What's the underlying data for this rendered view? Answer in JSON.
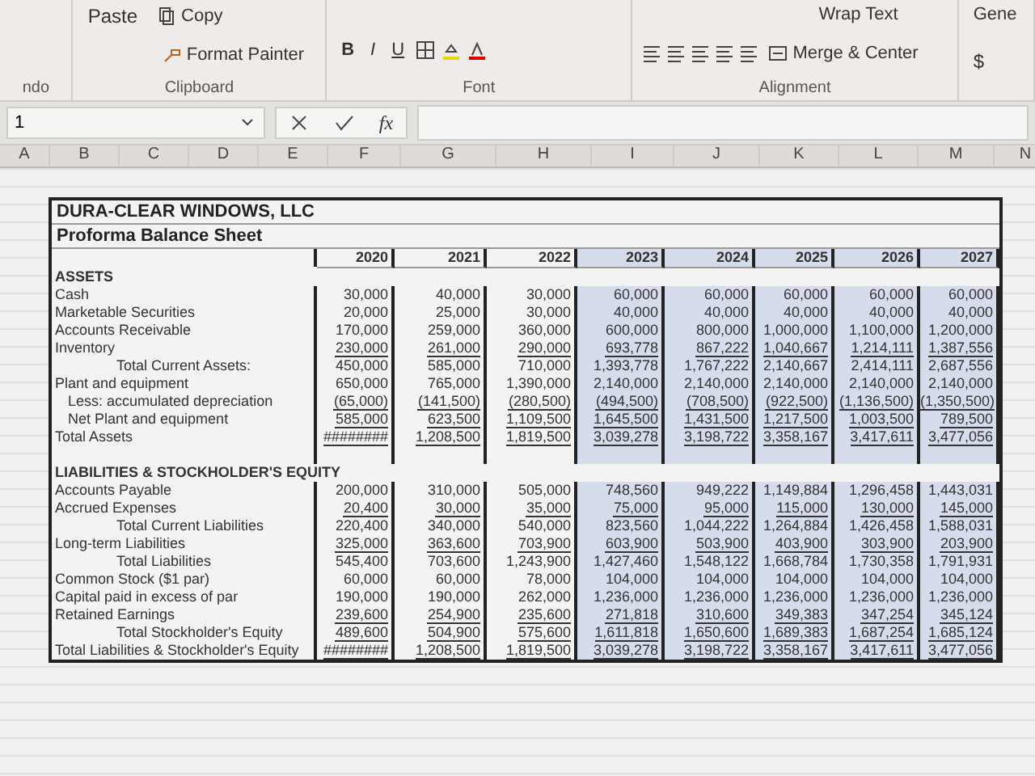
{
  "ribbon": {
    "undo_group": "ndo",
    "clipboard": {
      "paste": "Paste",
      "copy": "Copy",
      "format_painter": "Format Painter",
      "label": "Clipboard"
    },
    "font": {
      "bold": "B",
      "italic": "I",
      "underline": "U",
      "label": "Font"
    },
    "alignment": {
      "wrap_text": "Wrap Text",
      "merge": "Merge & Center",
      "label": "Alignment"
    },
    "number": {
      "format": "Gene",
      "currency": "$"
    }
  },
  "formula_bar": {
    "name_box": "1",
    "function_label": "fx"
  },
  "columns": [
    "A",
    "B",
    "C",
    "D",
    "E",
    "F",
    "G",
    "H",
    "I",
    "J",
    "K",
    "L",
    "M",
    "N"
  ],
  "sheet": {
    "title": "DURA-CLEAR WINDOWS, LLC",
    "subtitle": "Proforma Balance Sheet",
    "years": [
      {
        "label": "2020",
        "shaded": false
      },
      {
        "label": "2021",
        "shaded": false
      },
      {
        "label": "2022",
        "shaded": false
      },
      {
        "label": "2023",
        "shaded": true
      },
      {
        "label": "2024",
        "shaded": true
      },
      {
        "label": "2025",
        "shaded": true
      },
      {
        "label": "2026",
        "shaded": true
      },
      {
        "label": "2027",
        "shaded": true
      }
    ],
    "rows": [
      {
        "kind": "section",
        "label": "ASSETS",
        "values": []
      },
      {
        "kind": "item",
        "label": "Cash",
        "underlined": false,
        "values": [
          "30,000",
          "40,000",
          "30,000",
          "60,000",
          "60,000",
          "60,000",
          "60,000",
          "60,000"
        ]
      },
      {
        "kind": "item",
        "label": "Marketable Securities",
        "underlined": false,
        "values": [
          "20,000",
          "25,000",
          "30,000",
          "40,000",
          "40,000",
          "40,000",
          "40,000",
          "40,000"
        ]
      },
      {
        "kind": "item",
        "label": "Accounts Receivable",
        "underlined": false,
        "values": [
          "170,000",
          "259,000",
          "360,000",
          "600,000",
          "800,000",
          "1,000,000",
          "1,100,000",
          "1,200,000"
        ]
      },
      {
        "kind": "item",
        "label": "Inventory",
        "underlined": true,
        "values": [
          "230,000",
          "261,000",
          "290,000",
          "693,778",
          "867,222",
          "1,040,667",
          "1,214,111",
          "1,387,556"
        ]
      },
      {
        "kind": "total",
        "label": "Total Current Assets:",
        "underlined": false,
        "values": [
          "450,000",
          "585,000",
          "710,000",
          "1,393,778",
          "1,767,222",
          "2,140,667",
          "2,414,111",
          "2,687,556"
        ]
      },
      {
        "kind": "item",
        "label": "Plant and equipment",
        "underlined": false,
        "values": [
          "650,000",
          "765,000",
          "1,390,000",
          "2,140,000",
          "2,140,000",
          "2,140,000",
          "2,140,000",
          "2,140,000"
        ]
      },
      {
        "kind": "subitem",
        "label": "Less:  accumulated depreciation",
        "underlined": true,
        "values": [
          "(65,000)",
          "(141,500)",
          "(280,500)",
          "(494,500)",
          "(708,500)",
          "(922,500)",
          "(1,136,500)",
          "(1,350,500)"
        ]
      },
      {
        "kind": "subitem",
        "label": "Net Plant and equipment",
        "underlined": true,
        "values": [
          "585,000",
          "623,500",
          "1,109,500",
          "1,645,500",
          "1,431,500",
          "1,217,500",
          "1,003,500",
          "789,500"
        ]
      },
      {
        "kind": "item",
        "label": "Total Assets",
        "underlined": true,
        "values": [
          "########",
          "1,208,500",
          "1,819,500",
          "3,039,278",
          "3,198,722",
          "3,358,167",
          "3,417,611",
          "3,477,056"
        ]
      },
      {
        "kind": "blank",
        "values": []
      },
      {
        "kind": "section",
        "label": "LIABILITIES & STOCKHOLDER'S EQUITY",
        "values": []
      },
      {
        "kind": "item",
        "label": "Accounts Payable",
        "underlined": false,
        "values": [
          "200,000",
          "310,000",
          "505,000",
          "748,560",
          "949,222",
          "1,149,884",
          "1,296,458",
          "1,443,031"
        ]
      },
      {
        "kind": "item",
        "label": "Accrued Expenses",
        "underlined": true,
        "values": [
          "20,400",
          "30,000",
          "35,000",
          "75,000",
          "95,000",
          "115,000",
          "130,000",
          "145,000"
        ]
      },
      {
        "kind": "total",
        "label": "Total Current Liabilities",
        "underlined": false,
        "values": [
          "220,400",
          "340,000",
          "540,000",
          "823,560",
          "1,044,222",
          "1,264,884",
          "1,426,458",
          "1,588,031"
        ]
      },
      {
        "kind": "item",
        "label": "Long-term Liabilities",
        "underlined": true,
        "values": [
          "325,000",
          "363,600",
          "703,900",
          "603,900",
          "503,900",
          "403,900",
          "303,900",
          "203,900"
        ]
      },
      {
        "kind": "total",
        "label": "Total Liabilities",
        "underlined": false,
        "values": [
          "545,400",
          "703,600",
          "1,243,900",
          "1,427,460",
          "1,548,122",
          "1,668,784",
          "1,730,358",
          "1,791,931"
        ]
      },
      {
        "kind": "item",
        "label": "Common Stock ($1 par)",
        "underlined": false,
        "values": [
          "60,000",
          "60,000",
          "78,000",
          "104,000",
          "104,000",
          "104,000",
          "104,000",
          "104,000"
        ]
      },
      {
        "kind": "item",
        "label": "Capital paid in excess of par",
        "underlined": false,
        "values": [
          "190,000",
          "190,000",
          "262,000",
          "1,236,000",
          "1,236,000",
          "1,236,000",
          "1,236,000",
          "1,236,000"
        ]
      },
      {
        "kind": "item",
        "label": "Retained Earnings",
        "underlined": true,
        "values": [
          "239,600",
          "254,900",
          "235,600",
          "271,818",
          "310,600",
          "349,383",
          "347,254",
          "345,124"
        ]
      },
      {
        "kind": "total",
        "label": "Total Stockholder's Equity",
        "underlined": true,
        "values": [
          "489,600",
          "504,900",
          "575,600",
          "1,611,818",
          "1,650,600",
          "1,689,383",
          "1,687,254",
          "1,685,124"
        ]
      },
      {
        "kind": "item",
        "label": "Total Liabilities & Stockholder's Equity",
        "underlined": true,
        "values": [
          "########",
          "1,208,500",
          "1,819,500",
          "3,039,278",
          "3,198,722",
          "3,358,167",
          "3,417,611",
          "3,477,056"
        ]
      }
    ]
  }
}
